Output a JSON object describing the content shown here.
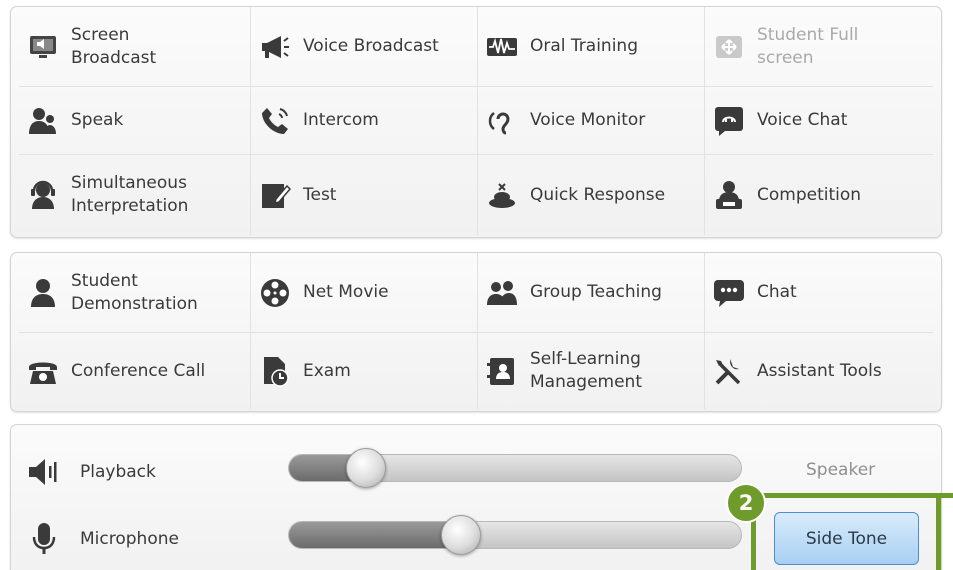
{
  "toolbar_top": [
    {
      "name": "screen-broadcast",
      "label": "Screen\nBroadcast",
      "icon": "monitor-speaker-icon"
    },
    {
      "name": "voice-broadcast",
      "label": "Voice Broadcast",
      "icon": "megaphone-icon"
    },
    {
      "name": "oral-training",
      "label": "Oral Training",
      "icon": "waveform-icon"
    },
    {
      "name": "student-full-screen",
      "label": "Student Full\nscreen",
      "icon": "fullscreen-icon",
      "disabled": true
    },
    {
      "name": "speak",
      "label": "Speak",
      "icon": "people-icon"
    },
    {
      "name": "intercom",
      "label": "Intercom",
      "icon": "phone-handset-icon"
    },
    {
      "name": "voice-monitor",
      "label": "Voice Monitor",
      "icon": "ear-icon"
    },
    {
      "name": "voice-chat",
      "label": "Voice Chat",
      "icon": "chat-bubble-icon"
    },
    {
      "name": "simultaneous-interpretation",
      "label": "Simultaneous\nInterpretation",
      "icon": "headset-person-icon"
    },
    {
      "name": "test",
      "label": "Test",
      "icon": "pencil-paper-icon"
    },
    {
      "name": "quick-response",
      "label": "Quick Response",
      "icon": "buzzer-icon"
    },
    {
      "name": "competition",
      "label": "Competition",
      "icon": "person-desk-icon"
    }
  ],
  "toolbar_bottom": [
    {
      "name": "student-demonstration",
      "label": "Student\nDemonstration",
      "icon": "person-icon"
    },
    {
      "name": "net-movie",
      "label": "Net Movie",
      "icon": "film-reel-icon"
    },
    {
      "name": "group-teaching",
      "label": "Group Teaching",
      "icon": "group-icon"
    },
    {
      "name": "chat",
      "label": "Chat",
      "icon": "speech-bubble-icon"
    },
    {
      "name": "conference-call",
      "label": "Conference Call",
      "icon": "telephone-icon"
    },
    {
      "name": "exam",
      "label": "Exam",
      "icon": "document-clock-icon"
    },
    {
      "name": "self-learning-management",
      "label": "Self-Learning\nManagement",
      "icon": "contact-book-icon"
    },
    {
      "name": "assistant-tools",
      "label": "Assistant Tools",
      "icon": "wrench-screwdriver-icon"
    }
  ],
  "audio": {
    "playback": {
      "label": "Playback",
      "icon": "speaker-icon",
      "level": 0.17
    },
    "microphone": {
      "label": "Microphone",
      "icon": "microphone-icon",
      "level": 0.38
    },
    "speaker_label": "Speaker",
    "side_tone_label": "Side Tone"
  },
  "callout": {
    "number": "2",
    "color": "#6f9b2a"
  }
}
